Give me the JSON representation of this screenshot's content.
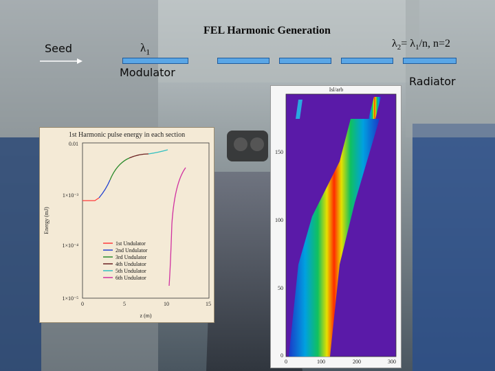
{
  "title": "FEL Harmonic Generation",
  "seed_label": "Seed",
  "lambda1": {
    "symbol": "λ",
    "sub": "1"
  },
  "lambda2": {
    "symbol": "λ",
    "sub2": "2",
    "eq": "= ",
    "sub1": "1",
    "tail": "/n, n=2"
  },
  "modulator_label": "Modulator",
  "radiator_label": "Radiator",
  "plot1": {
    "title": "1st Harmonic pulse energy in each section",
    "ylabel": "Energy (mJ)",
    "xlabel": "z (m)",
    "yticks": [
      "0.01",
      "1×10⁻³",
      "1×10⁻⁴",
      "1×10⁻⁵"
    ],
    "xticks": [
      "0",
      "5",
      "10",
      "15"
    ],
    "legend": [
      {
        "name": "1st Undulator",
        "color": "#ff3b3b"
      },
      {
        "name": "2nd Undulator",
        "color": "#2040d0"
      },
      {
        "name": "3rd Undulator",
        "color": "#2a8a2a"
      },
      {
        "name": "4th Undulator",
        "color": "#6a2020"
      },
      {
        "name": "5th Undulator",
        "color": "#30c0c0"
      },
      {
        "name": "6th Undulator",
        "color": "#d030a0"
      }
    ]
  },
  "plot2": {
    "top_label": "Isl/arb",
    "yticks": [
      "150",
      "100",
      "50",
      "0"
    ],
    "xticks": [
      "0",
      "100",
      "200",
      "300"
    ]
  }
}
